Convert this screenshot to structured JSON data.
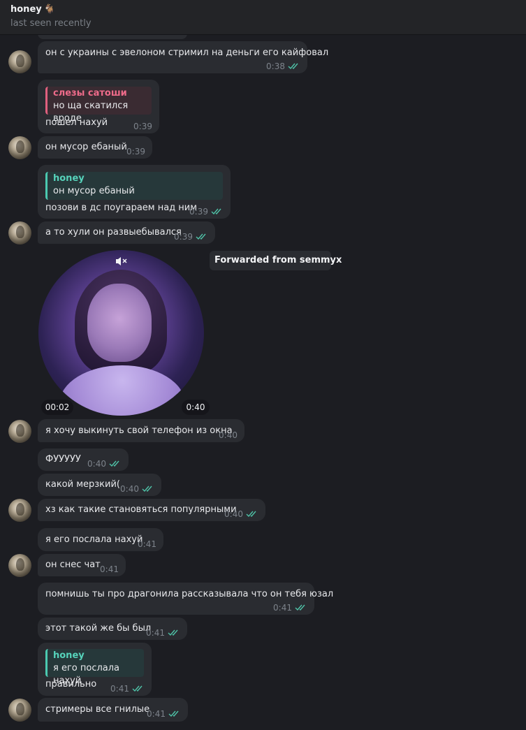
{
  "header": {
    "name": "honey",
    "emoji": "🐐",
    "status": "last seen recently"
  },
  "forwarded_label": "Forwarded from semmyx",
  "video": {
    "elapsed": "00:02",
    "duration": "0:40",
    "muted": true
  },
  "messages": [
    {
      "text": "он с украины с эвелоном стримил на деньги его кайфовал",
      "time": "0:38",
      "read": true
    },
    {
      "quote_author": "слезы сатоши",
      "quote_text": "но ща скатился вроде",
      "text": "пошел нахуй",
      "time": "0:39",
      "read": false
    },
    {
      "text": "он мусор ебаный",
      "time": "0:39",
      "read": false
    },
    {
      "quote_author": "honey",
      "quote_text": "он мусор ебаный",
      "text": "позови в дс поугараем над ним",
      "time": "0:39",
      "read": true
    },
    {
      "text": "а то хули он развыебывался",
      "time": "0:39",
      "read": true
    },
    {
      "text": "я хочу выкинуть свой телефон из окна",
      "time": "0:40",
      "read": false
    },
    {
      "text": "ФУУУУУ",
      "time": "0:40",
      "read": true
    },
    {
      "text": "какой мерзкий(",
      "time": "0:40",
      "read": true
    },
    {
      "text": "хз как такие становяться популярными",
      "time": "0:40",
      "read": true
    },
    {
      "text": "я его послала нахуй",
      "time": "0:41",
      "read": false
    },
    {
      "text": "он снес чат",
      "time": "0:41",
      "read": false
    },
    {
      "text": "помнишь ты про драгонила рассказывала что он тебя юзал",
      "time": "0:41",
      "read": true
    },
    {
      "text": "этот такой же бы был",
      "time": "0:41",
      "read": true
    },
    {
      "quote_author": "honey",
      "quote_text": "я его послала нахуй",
      "text": "правильно",
      "time": "0:41",
      "read": true
    },
    {
      "text": "стримеры все гнилые",
      "time": "0:41",
      "read": true
    }
  ]
}
